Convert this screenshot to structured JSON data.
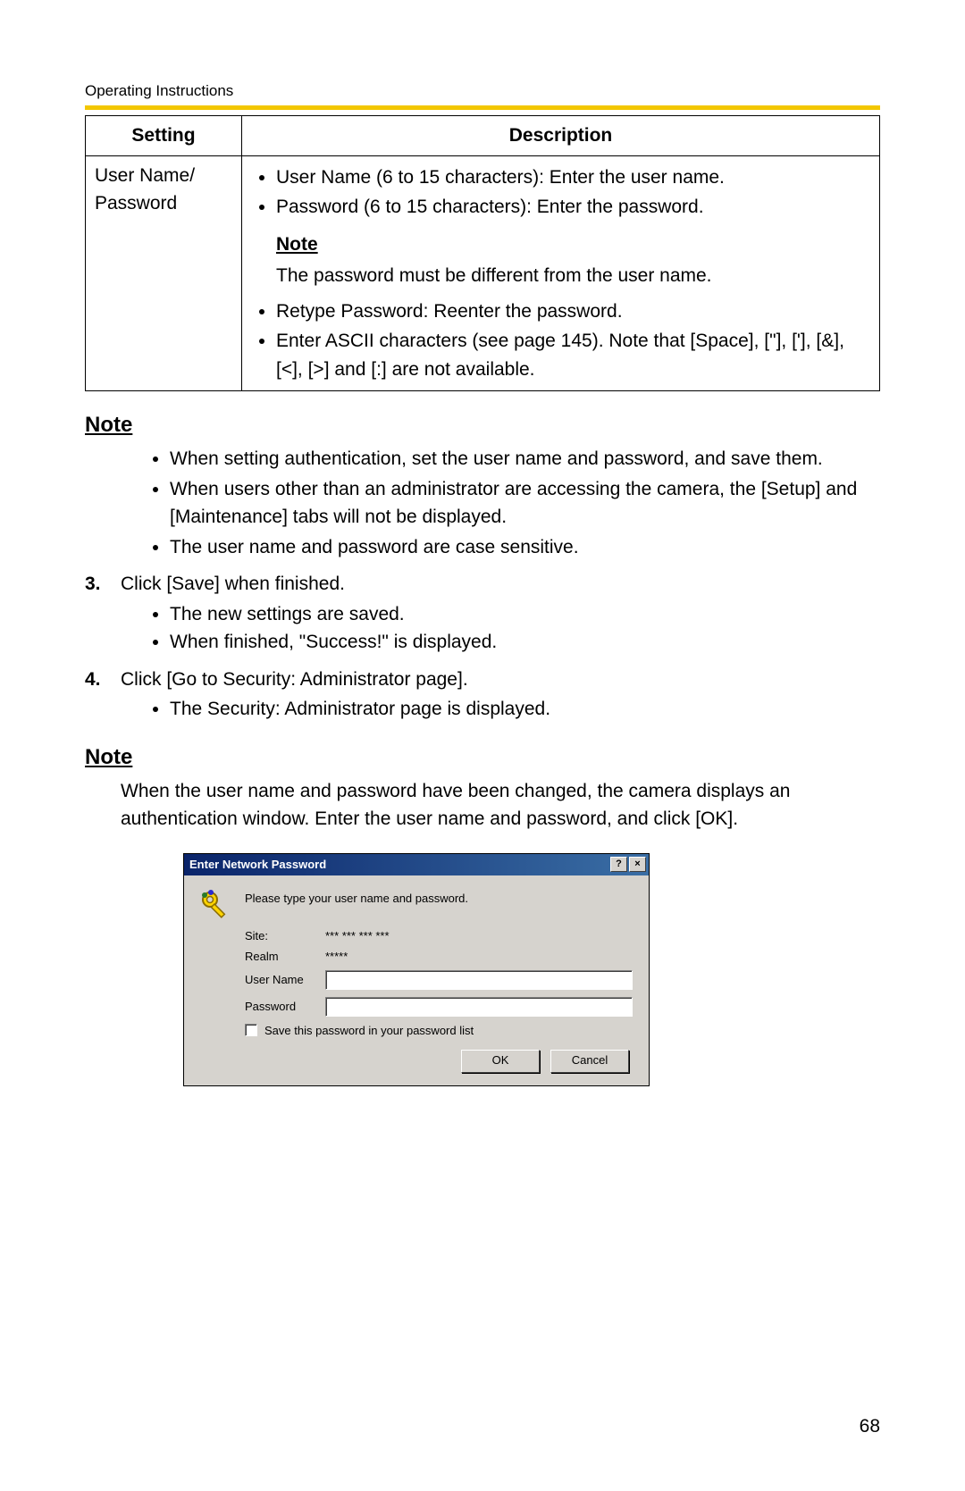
{
  "header": {
    "label": "Operating Instructions"
  },
  "table": {
    "col1": "Setting",
    "col2": "Description",
    "row": {
      "setting": "User Name/ Password",
      "b1": "User Name (6 to 15 characters): Enter the user name.",
      "b2": "Password (6 to 15 characters): Enter the password.",
      "note_label": "Note",
      "note_body": "The password must be different from the user name.",
      "b3": "Retype Password: Reenter the password.",
      "b4": "Enter ASCII characters (see page 145). Note that [Space], [\"], ['], [&], [<], [>] and [:] are not available."
    }
  },
  "note1": {
    "heading": "Note",
    "items": [
      "When setting authentication, set the user name and password, and save them.",
      "When users other than an administrator are accessing the camera, the [Setup] and [Maintenance] tabs will not be displayed.",
      "The user name and password are case sensitive."
    ]
  },
  "step3": {
    "num": "3.",
    "text": "Click [Save] when finished.",
    "items": [
      "The new settings are saved.",
      "When finished, \"Success!\" is displayed."
    ]
  },
  "step4": {
    "num": "4.",
    "text": "Click [Go to Security: Administrator page].",
    "items": [
      "The Security: Administrator page is displayed."
    ]
  },
  "note2": {
    "heading": "Note",
    "body": "When the user name and password have been changed, the camera displays an authentication window. Enter the user name and password, and click [OK]."
  },
  "dialog": {
    "title": "Enter Network Password",
    "help": "?",
    "close": "×",
    "prompt": "Please type your user name and password.",
    "site_label": "Site:",
    "site_value": "*** *** *** ***",
    "realm_label": "Realm",
    "realm_value": "*****",
    "user_label": "User Name",
    "pass_label": "Password",
    "save_cb": "Save this password in your password list",
    "ok": "OK",
    "cancel": "Cancel"
  },
  "page_number": "68"
}
